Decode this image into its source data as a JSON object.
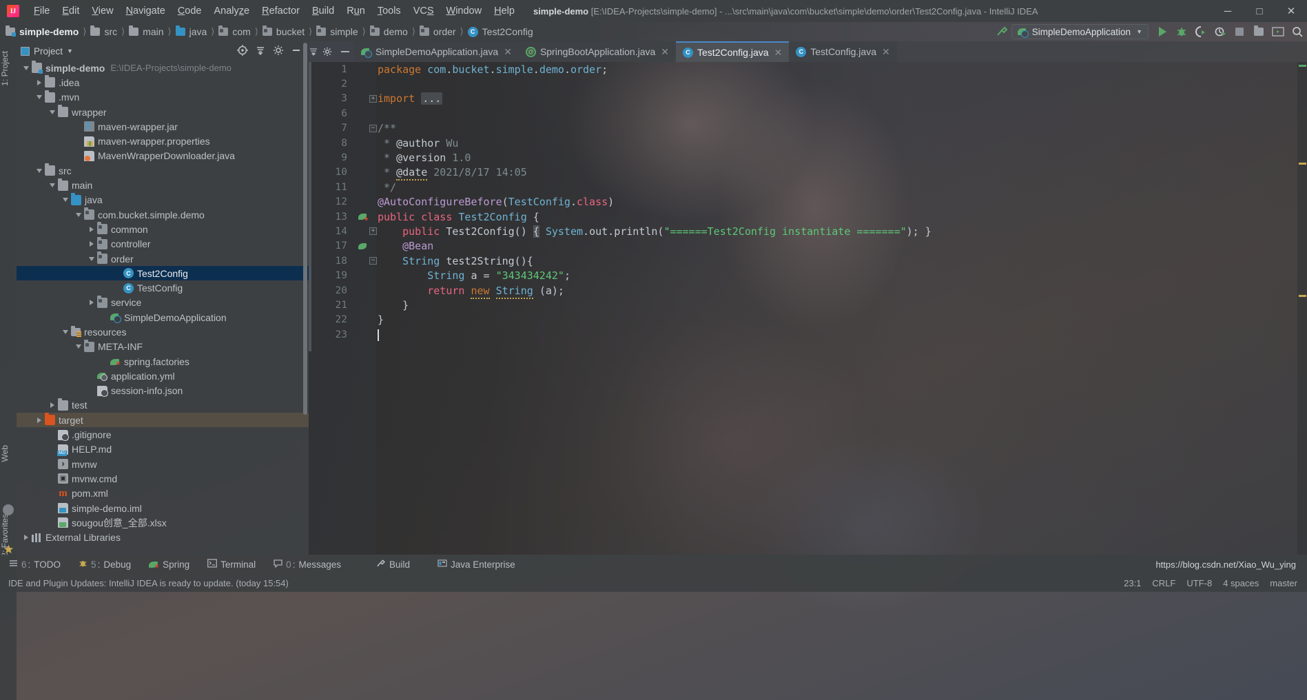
{
  "window": {
    "app_name": "IntelliJ IDEA",
    "title_project": "simple-demo",
    "title_path": "[E:\\IDEA-Projects\\simple-demo] - ...\\src\\main\\java\\com\\bucket\\simple\\demo\\order\\Test2Config.java - IntelliJ IDEA",
    "minimize": "─",
    "maximize": "□",
    "close": "✕"
  },
  "menu": [
    {
      "label": "File"
    },
    {
      "label": "Edit"
    },
    {
      "label": "View"
    },
    {
      "label": "Navigate"
    },
    {
      "label": "Code"
    },
    {
      "label": "Analyze"
    },
    {
      "label": "Refactor"
    },
    {
      "label": "Build"
    },
    {
      "label": "Run"
    },
    {
      "label": "Tools"
    },
    {
      "label": "VCS"
    },
    {
      "label": "Window"
    },
    {
      "label": "Help"
    }
  ],
  "breadcrumb": [
    {
      "label": "simple-demo",
      "icon": "module-icon",
      "active": true
    },
    {
      "label": "src",
      "icon": "folder-icon"
    },
    {
      "label": "main",
      "icon": "folder-icon"
    },
    {
      "label": "java",
      "icon": "folder-blue-icon"
    },
    {
      "label": "com",
      "icon": "package-icon"
    },
    {
      "label": "bucket",
      "icon": "package-icon"
    },
    {
      "label": "simple",
      "icon": "package-icon"
    },
    {
      "label": "demo",
      "icon": "package-icon"
    },
    {
      "label": "order",
      "icon": "package-icon"
    },
    {
      "label": "Test2Config",
      "icon": "class-icon"
    }
  ],
  "toolbar": {
    "run_config_name": "SimpleDemoApplication",
    "dropdown_arrow": "▼",
    "run_icon": "run-icon",
    "debug_icon": "debug-icon",
    "run_coverage_icon": "run-with-coverage-icon",
    "profile_icon": "profile-icon",
    "stop_icon": "stop-icon",
    "search_everywhere_icon": "search-everywhere-icon"
  },
  "left_strip": [
    {
      "label": "1: Project"
    },
    {
      "label": "Web"
    },
    {
      "label": "2: Favorites"
    }
  ],
  "project_panel": {
    "title": "Project",
    "dropdown_arrow": "▼",
    "tree": [
      {
        "label": "simple-demo",
        "sub": "E:\\IDEA-Projects\\simple-demo",
        "indent": 0,
        "twisty": "down",
        "icon": "module-icon",
        "bold": true
      },
      {
        "label": ".idea",
        "indent": 1,
        "twisty": "right",
        "icon": "folder-icon"
      },
      {
        "label": ".mvn",
        "indent": 1,
        "twisty": "down",
        "icon": "folder-icon"
      },
      {
        "label": "wrapper",
        "indent": 2,
        "twisty": "down",
        "icon": "folder-icon"
      },
      {
        "label": "maven-wrapper.jar",
        "indent": 4,
        "twisty": "none",
        "icon": "jar-file-icon"
      },
      {
        "label": "maven-wrapper.properties",
        "indent": 4,
        "twisty": "none",
        "icon": "properties-file-icon"
      },
      {
        "label": "MavenWrapperDownloader.java",
        "indent": 4,
        "twisty": "none",
        "icon": "java-file-icon"
      },
      {
        "label": "src",
        "indent": 1,
        "twisty": "down",
        "icon": "folder-icon"
      },
      {
        "label": "main",
        "indent": 2,
        "twisty": "down",
        "icon": "folder-icon"
      },
      {
        "label": "java",
        "indent": 3,
        "twisty": "down",
        "icon": "folder-blue-icon"
      },
      {
        "label": "com.bucket.simple.demo",
        "indent": 4,
        "twisty": "down",
        "icon": "package-icon"
      },
      {
        "label": "common",
        "indent": 5,
        "twisty": "right",
        "icon": "package-icon"
      },
      {
        "label": "controller",
        "indent": 5,
        "twisty": "right",
        "icon": "package-icon"
      },
      {
        "label": "order",
        "indent": 5,
        "twisty": "down",
        "icon": "package-icon"
      },
      {
        "label": "Test2Config",
        "indent": 7,
        "twisty": "none",
        "icon": "class-icon",
        "selected": true
      },
      {
        "label": "TestConfig",
        "indent": 7,
        "twisty": "none",
        "icon": "class-icon"
      },
      {
        "label": "service",
        "indent": 5,
        "twisty": "right",
        "icon": "package-icon"
      },
      {
        "label": "SimpleDemoApplication",
        "indent": 6,
        "twisty": "none",
        "icon": "spring-app-icon"
      },
      {
        "label": "resources",
        "indent": 3,
        "twisty": "down",
        "icon": "resources-folder-icon"
      },
      {
        "label": "META-INF",
        "indent": 4,
        "twisty": "down",
        "icon": "package-icon"
      },
      {
        "label": "spring.factories",
        "indent": 6,
        "twisty": "none",
        "icon": "spring-file-icon"
      },
      {
        "label": "application.yml",
        "indent": 5,
        "twisty": "none",
        "icon": "spring-yaml-icon"
      },
      {
        "label": "session-info.json",
        "indent": 5,
        "twisty": "none",
        "icon": "json-file-icon"
      },
      {
        "label": "test",
        "indent": 2,
        "twisty": "right",
        "icon": "folder-icon"
      },
      {
        "label": "target",
        "indent": 1,
        "twisty": "right",
        "icon": "folder-orange-icon",
        "highlight": true
      },
      {
        "label": ".gitignore",
        "indent": 2,
        "twisty": "none",
        "icon": "gitignore-file-icon"
      },
      {
        "label": "HELP.md",
        "indent": 2,
        "twisty": "none",
        "icon": "markdown-file-icon"
      },
      {
        "label": "mvnw",
        "indent": 2,
        "twisty": "none",
        "icon": "shell-file-icon"
      },
      {
        "label": "mvnw.cmd",
        "indent": 2,
        "twisty": "none",
        "icon": "cmd-file-icon"
      },
      {
        "label": "pom.xml",
        "indent": 2,
        "twisty": "none",
        "icon": "maven-pom-icon"
      },
      {
        "label": "simple-demo.iml",
        "indent": 2,
        "twisty": "none",
        "icon": "iml-file-icon"
      },
      {
        "label": "sougou创意_全部.xlsx",
        "indent": 2,
        "twisty": "none",
        "icon": "xlsx-file-icon"
      },
      {
        "label": "External Libraries",
        "indent": 0,
        "twisty": "right",
        "icon": "library-icon"
      }
    ]
  },
  "editor_tabs": [
    {
      "label": "SimpleDemoApplication.java",
      "icon": "spring-app-icon",
      "close": "✕",
      "active": false
    },
    {
      "label": "SpringBootApplication.java",
      "icon": "annotation-icon",
      "close": "✕",
      "active": false
    },
    {
      "label": "Test2Config.java",
      "icon": "class-icon",
      "close": "✕",
      "active": true
    },
    {
      "label": "TestConfig.java",
      "icon": "class-icon",
      "close": "✕",
      "active": false
    }
  ],
  "code": {
    "file_name": "Test2Config.java",
    "lines": [
      {
        "n": "1",
        "html": "<span class=\"k\">package</span> <span class=\"cls\">com</span><span class=\"plain\">.</span><span class=\"cls\">bucket</span><span class=\"plain\">.</span><span class=\"cls\">simple</span><span class=\"plain\">.</span><span class=\"cls\">demo</span><span class=\"plain\">.</span><span class=\"cls\">order</span><span class=\"plain\">;</span>",
        "text": "package com.bucket.simple.demo.order;"
      },
      {
        "n": "2",
        "html": "",
        "text": ""
      },
      {
        "n": "3",
        "html": "<span class=\"k\">import</span> <span class=\"importbox plain\">...</span>",
        "text": "import ...",
        "fold": "plus"
      },
      {
        "n": "6",
        "html": "",
        "text": ""
      },
      {
        "n": "7",
        "html": "<span class=\"cmt\">/**</span>",
        "text": "/**",
        "fold": "minus"
      },
      {
        "n": "8",
        "html": "<span class=\"cmt\"> * </span><span class=\"plain\">@author</span><span class=\"cmt\"> Wu</span>",
        "text": " * @author Wu"
      },
      {
        "n": "9",
        "html": "<span class=\"cmt\"> * </span><span class=\"plain\">@version</span><span class=\"cmt\"> 1.0</span>",
        "text": " * @version 1.0"
      },
      {
        "n": "10",
        "html": "<span class=\"cmt\"> * </span><span class=\"plain squiggle\">@date</span><span class=\"cmt\"> 2021/8/17 14:05</span>",
        "text": " * @date 2021/8/17 14:05"
      },
      {
        "n": "11",
        "html": "<span class=\"cmt\"> */</span>",
        "text": " */"
      },
      {
        "n": "12",
        "html": "<span class=\"anno\">@AutoConfigureBefore</span><span class=\"plain\">(</span><span class=\"cls\">TestConfig</span><span class=\"plain\">.</span><span class=\"kw-pink\">class</span><span class=\"plain\">)</span>",
        "text": "@AutoConfigureBefore(TestConfig.class)"
      },
      {
        "n": "13",
        "html": "<span class=\"kw-pink\">public class</span> <span class=\"cls\">Test2Config</span> <span class=\"plain\">{</span>",
        "text": "public class Test2Config {",
        "marker": "spring-bean-marker"
      },
      {
        "n": "14",
        "html": "    <span class=\"kw-pink\">public</span> <span class=\"plain\">Test2Config() </span><span class=\"bracehl plain\">{</span><span class=\"plain\"> </span><span class=\"cls\">System</span><span class=\"plain\">.</span><span class=\"plain\">out</span><span class=\"plain\">.</span><span class=\"plain\">println(</span><span class=\"str\">\"======Test2Config instantiate =======\"</span><span class=\"plain\">); }</span>",
        "text": "    public Test2Config() { System.out.println(\"======Test2Config instantiate =======\"); }",
        "fold": "plus"
      },
      {
        "n": "17",
        "html": "    <span class=\"anno\">@Bean</span>",
        "text": "    @Bean",
        "marker": "bean-marker"
      },
      {
        "n": "18",
        "html": "    <span class=\"cls\">String</span> <span class=\"plain\">test2String(){</span>",
        "text": "    String test2String(){",
        "fold": "minus"
      },
      {
        "n": "19",
        "html": "        <span class=\"cls\">String</span> <span class=\"plain\">a = </span><span class=\"str\">\"343434242\"</span><span class=\"plain\">;</span>",
        "text": "        String a = \"343434242\";"
      },
      {
        "n": "20",
        "html": "        <span class=\"kw-pink\">return</span> <span class=\"k squiggle\">new</span> <span class=\"cls squiggle\">String</span> <span class=\"plain\">(a);</span>",
        "text": "        return new String (a);"
      },
      {
        "n": "21",
        "html": "    <span class=\"plain\">}</span>",
        "text": "    }"
      },
      {
        "n": "22",
        "html": "<span class=\"plain\">}</span>",
        "text": "}"
      },
      {
        "n": "23",
        "html": "<span class=\"caret\"></span>",
        "text": ""
      }
    ]
  },
  "bottom_bar": [
    {
      "num": "6",
      "label": "TODO",
      "icon": "todo-icon"
    },
    {
      "num": "5",
      "label": "Debug",
      "icon": "debug-icon"
    },
    {
      "num": "",
      "label": "Spring",
      "icon": "spring-icon"
    },
    {
      "num": "",
      "label": "Terminal",
      "icon": "terminal-icon"
    },
    {
      "num": "0",
      "label": "Messages",
      "icon": "messages-icon"
    },
    {
      "num": "",
      "label": "Build",
      "icon": "build-icon"
    },
    {
      "num": "",
      "label": "Java Enterprise",
      "icon": "java-enterprise-icon"
    }
  ],
  "status_bar": {
    "message": "IDE and Plugin Updates: IntelliJ IDEA is ready to update. (today 15:54)",
    "caret_position": "23:1",
    "line_separator": "CRLF",
    "encoding": "UTF-8",
    "indent": "4 spaces",
    "branch": "master"
  },
  "watermark": "https://blog.csdn.net/Xiao_Wu_ying"
}
